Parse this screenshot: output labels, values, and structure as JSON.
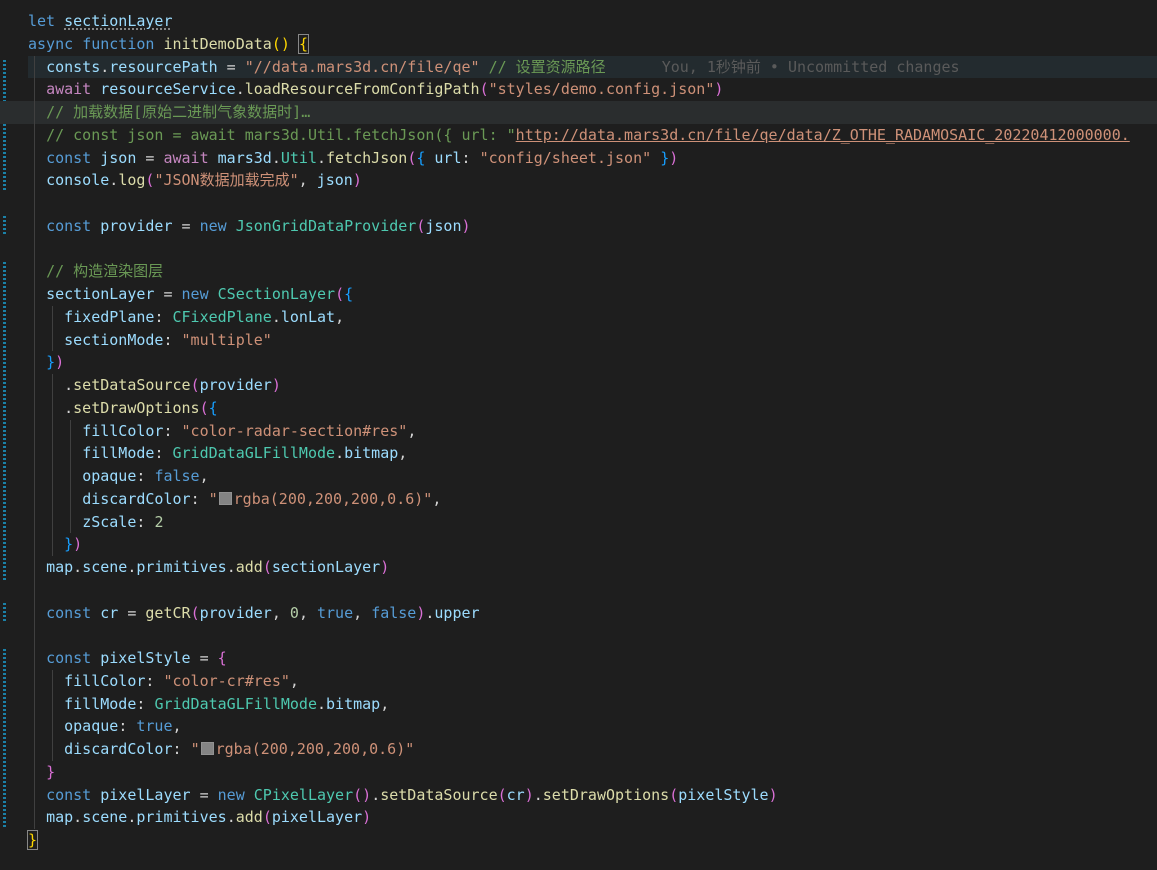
{
  "code": {
    "l1": [
      "let",
      "sectionLayer"
    ],
    "l2": [
      "async",
      "function",
      "initDemoData",
      "()",
      "{"
    ],
    "l3": [
      "consts",
      "resourcePath",
      "\"//data.mars3d.cn/file/qe\"",
      "// 设置资源路径",
      "You, 1秒钟前 • Uncommitted changes"
    ],
    "l4": [
      "await",
      "resourceService",
      "loadResourceFromConfigPath",
      "\"styles/demo.config.json\""
    ],
    "l5": [
      "// 加载数据[原始二进制气象数据时]…"
    ],
    "l6": [
      "// const json = await mars3d.Util.fetchJson({ url: \"",
      "http://data.mars3d.cn/file/qe/data/Z_OTHE_RADAMOSAIC_20220412000000."
    ],
    "l7": [
      "const",
      "json",
      "await",
      "mars3d",
      "Util",
      "fetchJson",
      "url",
      "\"config/sheet.json\""
    ],
    "l8": [
      "console",
      "log",
      "\"JSON数据加载完成\"",
      "json"
    ],
    "l10": [
      "const",
      "provider",
      "new",
      "JsonGridDataProvider",
      "json"
    ],
    "l12": [
      "// 构造渲染图层"
    ],
    "l13": [
      "sectionLayer",
      "new",
      "CSectionLayer"
    ],
    "l14": [
      "fixedPlane",
      "CFixedPlane",
      "lonLat"
    ],
    "l15": [
      "sectionMode",
      "\"multiple\""
    ],
    "l17": [
      "setDataSource",
      "provider"
    ],
    "l18": [
      "setDrawOptions"
    ],
    "l19": [
      "fillColor",
      "\"color-radar-section#res\""
    ],
    "l20": [
      "fillMode",
      "GridDataGLFillMode",
      "bitmap"
    ],
    "l21": [
      "opaque",
      "false"
    ],
    "l22": [
      "discardColor",
      "\"",
      "rgba(200,200,200,0.6)\""
    ],
    "l23": [
      "zScale",
      "2"
    ],
    "l25": [
      "map",
      "scene",
      "primitives",
      "add",
      "sectionLayer"
    ],
    "l27": [
      "const",
      "cr",
      "getCR",
      "provider",
      "0",
      "true",
      "false",
      "upper"
    ],
    "l29": [
      "const",
      "pixelStyle"
    ],
    "l30": [
      "fillColor",
      "\"color-cr#res\""
    ],
    "l31": [
      "fillMode",
      "GridDataGLFillMode",
      "bitmap"
    ],
    "l32": [
      "opaque",
      "true"
    ],
    "l33": [
      "discardColor",
      "\"",
      "rgba(200,200,200,0.6)\""
    ],
    "l35": [
      "const",
      "pixelLayer",
      "new",
      "CPixelLayer",
      "setDataSource",
      "cr",
      "setDrawOptions",
      "pixelStyle"
    ],
    "l36": [
      "map",
      "scene",
      "primitives",
      "add",
      "pixelLayer"
    ]
  },
  "gutter": {
    "fold_icon": "chevron-right-icon"
  },
  "colors": {
    "background": "#1e1e1e",
    "keyword": "#569cd6",
    "control": "#c586c0",
    "variable": "#9cdcfe",
    "function": "#dcdcaa",
    "class": "#4ec9b0",
    "string": "#ce9178",
    "number": "#b5cea8",
    "comment": "#6a9955"
  }
}
